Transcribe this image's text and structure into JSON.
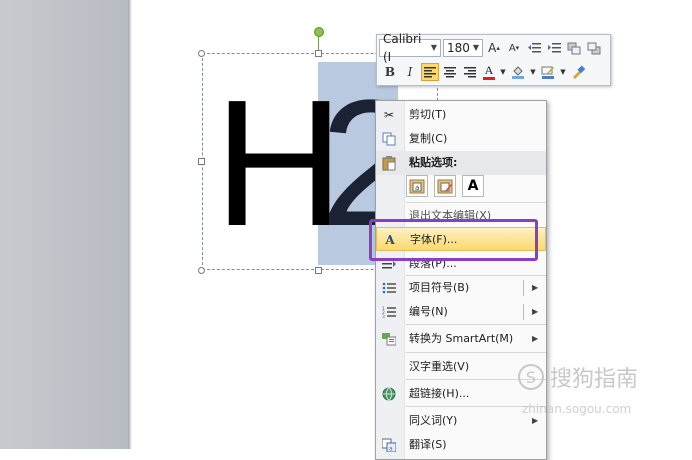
{
  "slide": {
    "letter_h": "H",
    "letter_2": "2"
  },
  "mini_toolbar": {
    "font_name": "Calibri (I",
    "font_size": "180",
    "grow_font": "A",
    "shrink_font": "A",
    "bold": "B",
    "italic": "I",
    "font_color": "A"
  },
  "context_menu": {
    "cut": "剪切(T)",
    "copy": "复制(C)",
    "paste_options": "粘贴选项:",
    "exit_edit": "退出文本编辑(X)",
    "font": "字体(F)...",
    "paragraph": "段落(P)...",
    "bullets": "项目符号(B)",
    "numbering": "编号(N)",
    "convert_smartart": "转换为 SmartArt(M)",
    "hanzi_reselect": "汉字重选(V)",
    "hyperlink": "超链接(H)...",
    "synonyms": "同义词(Y)",
    "translate": "翻译(S)",
    "paste_keep_text": "A"
  },
  "watermark": {
    "text": "搜狗指南",
    "url": "zhinan.sogou.com"
  },
  "colors": {
    "highlight_outline": "#8a3ec3",
    "selection": "#b9c9e0",
    "menu_hover": "#fbd96e"
  }
}
